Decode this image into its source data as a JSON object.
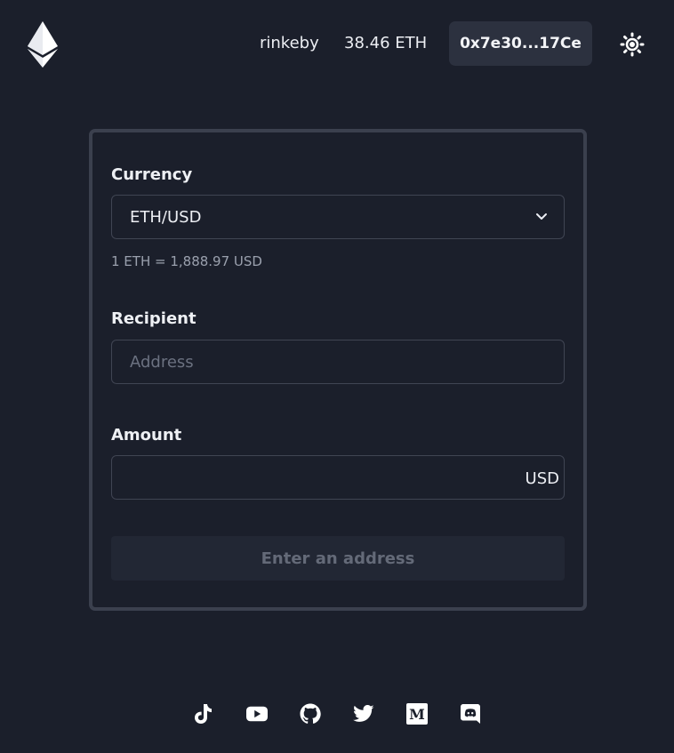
{
  "header": {
    "logo_icon": "ethereum-logo-icon",
    "network": "rinkeby",
    "balance": "38.46 ETH",
    "account": "0x7e30...17Ce",
    "theme_icon": "sun-icon"
  },
  "form": {
    "currency_label": "Currency",
    "currency_value": "ETH/USD",
    "currency_options": [
      "ETH/USD"
    ],
    "rate_text": "1 ETH = 1,888.97 USD",
    "recipient_label": "Recipient",
    "recipient_placeholder": "Address",
    "recipient_value": "",
    "amount_label": "Amount",
    "amount_value": "",
    "amount_unit": "USD",
    "submit_label": "Enter an address"
  },
  "footer": {
    "links": [
      "tiktok-icon",
      "youtube-icon",
      "github-icon",
      "twitter-icon",
      "medium-icon",
      "discord-icon"
    ]
  },
  "colors": {
    "background": "#1b1f2b",
    "card_border": "#3b404e",
    "button_bg": "#2c313f",
    "disabled_text": "#646a78"
  }
}
